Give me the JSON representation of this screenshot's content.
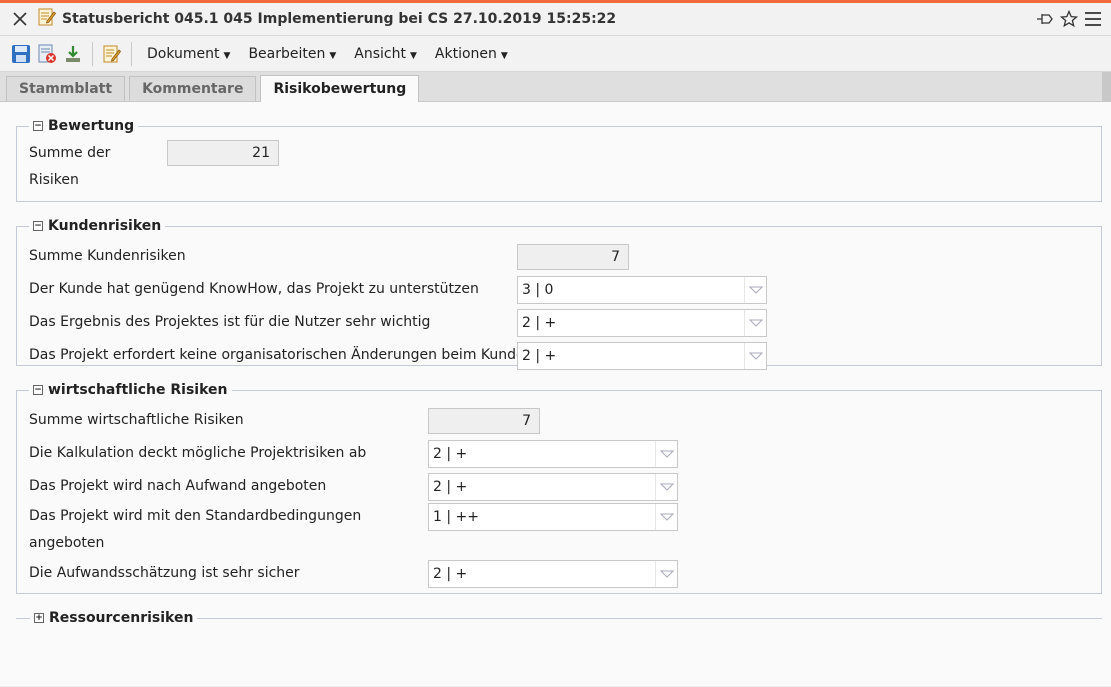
{
  "window": {
    "title": "Statusbericht 045.1 045 Implementierung bei CS 27.10.2019 15:25:22"
  },
  "toolbar": {
    "menus": [
      "Dokument",
      "Bearbeiten",
      "Ansicht",
      "Aktionen"
    ]
  },
  "tabs": [
    "Stammblatt",
    "Kommentare",
    "Risikobewertung"
  ],
  "active_tab": "Risikobewertung",
  "sections": {
    "bewertung": {
      "title": "Bewertung",
      "toggle": "−",
      "sum_label_line1": "Summe der",
      "sum_label_line2": "Risiken",
      "sum_value": "21"
    },
    "kunden": {
      "title": "Kundenrisiken",
      "toggle": "−",
      "sum_label": "Summe Kundenrisiken",
      "sum_value": "7",
      "items": [
        {
          "label": "Der Kunde hat genügend KnowHow, das Projekt zu unterstützen",
          "value": "3 | 0"
        },
        {
          "label": "Das Ergebnis des Projektes ist für die Nutzer sehr wichtig",
          "value": "2 | +"
        },
        {
          "label": "Das Projekt erfordert keine organisatorischen Änderungen beim Kunden",
          "value": "2 | +"
        }
      ]
    },
    "wirtschaft": {
      "title": "wirtschaftliche Risiken",
      "toggle": "−",
      "sum_label": "Summe wirtschaftliche Risiken",
      "sum_value": "7",
      "items": [
        {
          "label": "Die Kalkulation deckt mögliche Projektrisiken ab",
          "value": "2 | +"
        },
        {
          "label": "Das Projekt wird nach Aufwand angeboten",
          "value": "2 | +"
        },
        {
          "label": "Das Projekt wird mit den Standardbedingungen",
          "label2": "angeboten",
          "value": "1 | ++"
        },
        {
          "label": "Die Aufwandsschätzung ist sehr sicher",
          "value": "2 | +"
        }
      ]
    },
    "ressourcen": {
      "title": "Ressourcenrisiken",
      "toggle": "+"
    }
  },
  "icons": {
    "close": "close-icon",
    "document": "document-edit-icon",
    "pin": "pin-icon",
    "star": "star-icon",
    "menu": "hamburger-menu-icon",
    "save": "save-icon",
    "delete": "delete-document-icon",
    "download": "download-icon",
    "edit": "edit-document-icon"
  },
  "colors": {
    "accent": "#f26a3a"
  }
}
